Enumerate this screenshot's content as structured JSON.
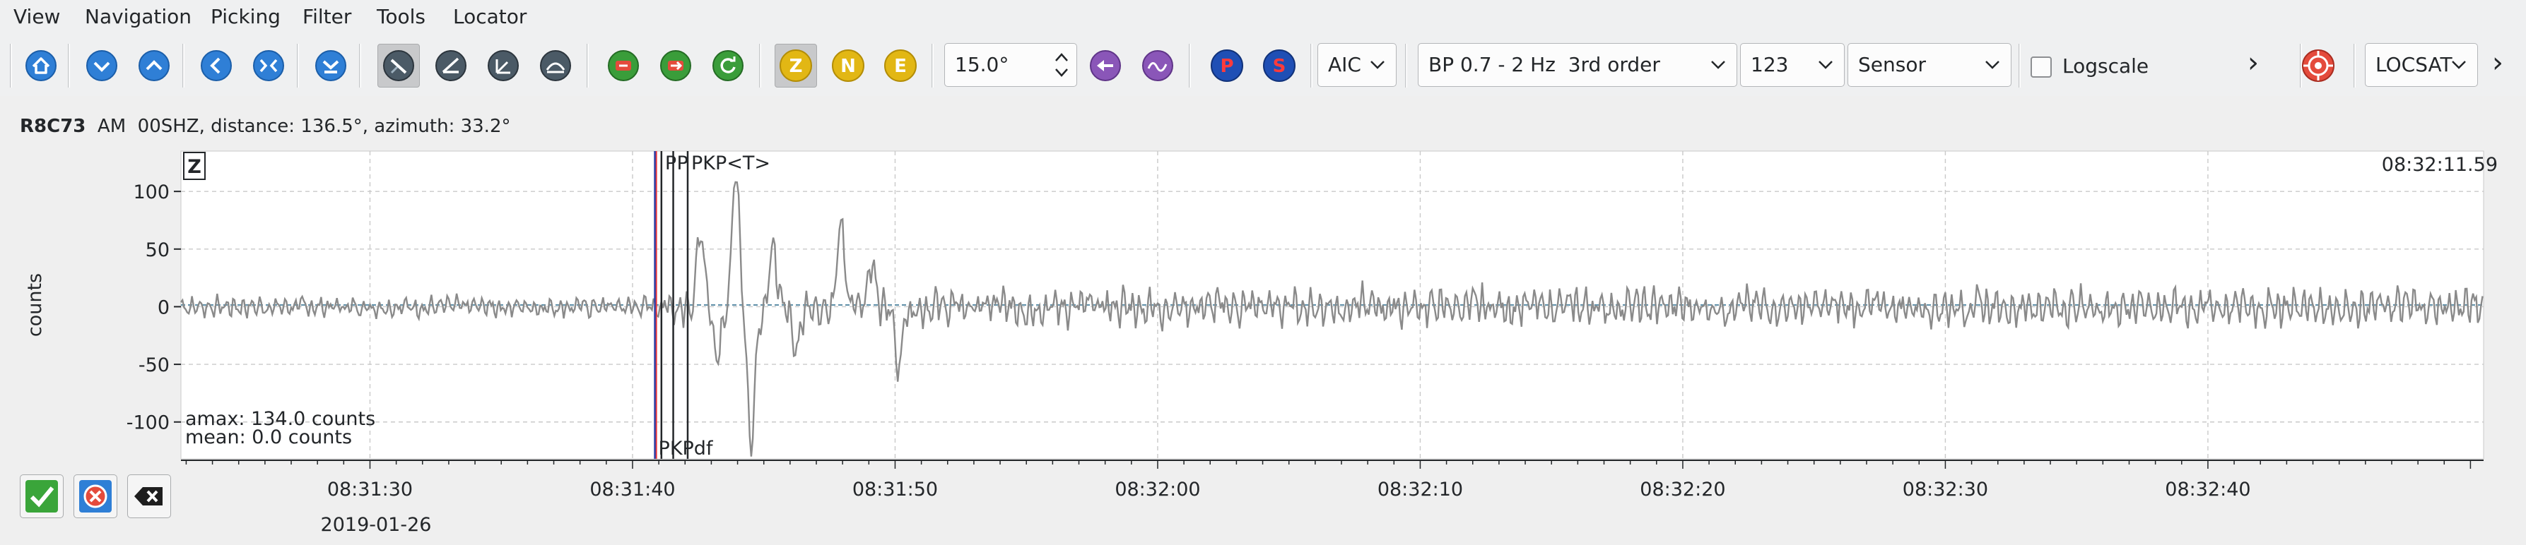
{
  "menu": [
    "View",
    "Navigation",
    "Picking",
    "Filter",
    "Tools",
    "Locator"
  ],
  "toolbar": {
    "component_buttons": [
      "Z",
      "N",
      "E"
    ],
    "phase_buttons": [
      "P",
      "S"
    ],
    "amplitude_value": "15.0°",
    "picker_value": "AIC",
    "filter_value": "BP 0.7 - 2 Hz  3rd order",
    "filter_number_value": "123",
    "unit_value": "Sensor",
    "logscale_label": "Logscale",
    "locator_value": "LOCSAT",
    "more_glyph": "›"
  },
  "trace": {
    "station": "R8C73",
    "header_rest": "  AM  00SHZ, distance: 136.5°, azimuth: 33.2°",
    "component": "Z",
    "time_label": "08:32:11.59",
    "ylabel": "counts",
    "amax_text": "amax: 134.0 counts",
    "mean_text": "mean: 0.0 counts",
    "date_label": "2019-01-26"
  },
  "picks": [
    {
      "time_s": 40.9,
      "label": "",
      "color": "#e8383d",
      "line_color": "#e8383d",
      "position": "top"
    },
    {
      "time_s": 41.55,
      "label": "P",
      "color": "#232629",
      "line_color": "#232629",
      "position": "top"
    },
    {
      "time_s": 41.1,
      "label": "P",
      "color": "#2ea043",
      "line_color": "#232629",
      "position": "top"
    },
    {
      "time_s": 42.1,
      "label": "PKP<T>",
      "color": "#232629",
      "line_color": "#232629",
      "position": "top"
    },
    {
      "time_s": 40.85,
      "label": "PKPdf",
      "color": "#2b3fa8",
      "line_color": "#2b3fa8",
      "position": "bottom"
    }
  ],
  "chart_data": {
    "type": "line",
    "xlabel": "",
    "ylabel": "counts",
    "x_ticks": [
      "08:31:30",
      "08:31:40",
      "08:31:50",
      "08:32:00",
      "08:32:10",
      "08:32:20",
      "08:32:30",
      "08:32:40"
    ],
    "x_tick_seconds": [
      30,
      40,
      50,
      60,
      70,
      80,
      90,
      100
    ],
    "xlim_seconds_after_08_31": [
      22.8,
      110.5
    ],
    "y_ticks": [
      100,
      50,
      0,
      -50,
      -100
    ],
    "ylim": [
      -132,
      135
    ],
    "grid": true,
    "series": [
      {
        "noise_amplitude": 13,
        "signal_onset_s": 41.0,
        "peaks": [
          {
            "t": 42.55,
            "v": 78
          },
          {
            "t": 43.2,
            "v": -55
          },
          {
            "t": 43.9,
            "v": 126
          },
          {
            "t": 44.5,
            "v": -128
          },
          {
            "t": 45.3,
            "v": 60
          },
          {
            "t": 46.2,
            "v": -42
          },
          {
            "t": 47.9,
            "v": 75
          },
          {
            "t": 49.1,
            "v": 45
          },
          {
            "t": 50.1,
            "v": -55
          }
        ]
      }
    ]
  }
}
